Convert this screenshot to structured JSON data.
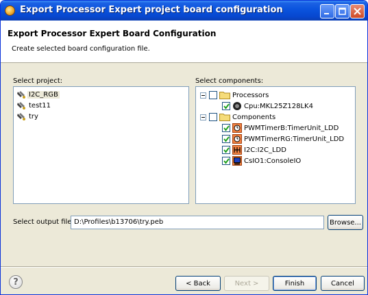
{
  "window": {
    "title": "Export Processor Expert project board configuration"
  },
  "header": {
    "title": "Export Processor Expert Board Configuration",
    "description": "Create selected board configuration file."
  },
  "projects": {
    "label": "Select project:",
    "items": [
      "I2C_RGB",
      "test11",
      "try"
    ],
    "selected": "I2C_RGB"
  },
  "components": {
    "label": "Select components:",
    "groups": [
      {
        "label": "Processors",
        "checked": false,
        "items": [
          {
            "label": "Cpu:MKL25Z128LK4",
            "checked": true,
            "icon": "cpu-icon"
          }
        ]
      },
      {
        "label": "Components",
        "checked": false,
        "items": [
          {
            "label": "PWMTimerB:TimerUnit_LDD",
            "checked": true,
            "icon": "timer-icon"
          },
          {
            "label": "PWMTimerRG:TimerUnit_LDD",
            "checked": true,
            "icon": "timer-icon"
          },
          {
            "label": "I2C:I2C_LDD",
            "checked": true,
            "icon": "i2c-icon"
          },
          {
            "label": "CsIO1:ConsoleIO",
            "checked": true,
            "icon": "console-icon"
          }
        ]
      }
    ]
  },
  "output": {
    "label": "Select output file:",
    "value": "D:\\Profiles\\b13706\\try.peb",
    "browse_label": "Browse..."
  },
  "footer": {
    "back_label": "< Back",
    "next_label": "Next >",
    "finish_label": "Finish",
    "cancel_label": "Cancel",
    "help_glyph": "?"
  }
}
